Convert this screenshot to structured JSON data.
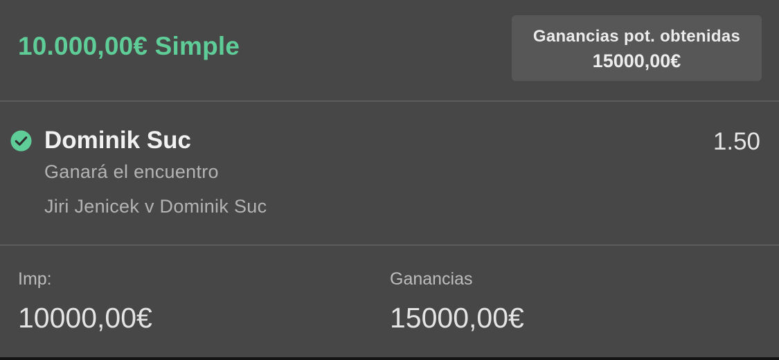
{
  "bet": {
    "header_title": "10.000,00€ Simple",
    "potential_returns_label": "Ganancias pot. obtenidas",
    "potential_returns_value": "15000,00€"
  },
  "selection": {
    "status_icon": "check-circle-icon",
    "name": "Dominik Suc",
    "odds": "1.50",
    "market": "Ganará el encuentro",
    "event": "Jiri Jenicek v Dominik Suc"
  },
  "summary": {
    "stake_label": "Imp:",
    "stake_value": "10000,00€",
    "returns_label": "Ganancias",
    "returns_value": "15000,00€"
  },
  "colors": {
    "background": "#474747",
    "accent_green": "#5fcd98",
    "box_background": "#575757",
    "divider": "#5c5c5c"
  }
}
